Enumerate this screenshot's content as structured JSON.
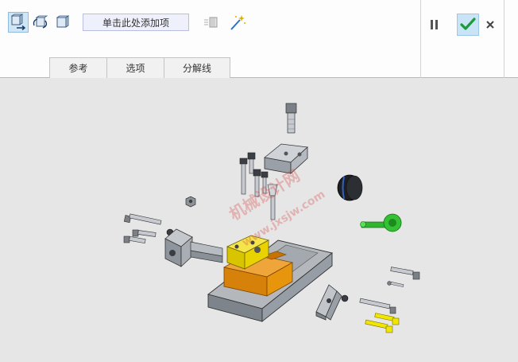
{
  "toolbar": {
    "collector_label": "单击此处添加项",
    "tools": [
      {
        "icon": "move-part-icon",
        "active": true
      },
      {
        "icon": "rotate-part-icon",
        "active": false
      },
      {
        "icon": "component-icon",
        "active": false
      },
      {
        "icon": "explode-lines-icon",
        "active": false
      },
      {
        "icon": "magic-wand-icon",
        "active": false
      }
    ]
  },
  "tabs": [
    {
      "label": "参考"
    },
    {
      "label": "选项"
    },
    {
      "label": "分解线"
    }
  ],
  "controls": {
    "pause": "pause-icon",
    "ok": "check-icon",
    "cancel": "close-icon"
  },
  "watermark": {
    "line1": "机械设计网",
    "line2": "www.jxsjw.com"
  },
  "colors": {
    "accent_ok": "#1d9a3a",
    "selected_part": "#2fb52f",
    "block_yellow": "#e8d300",
    "block_orange": "#e08a0a",
    "base_gray": "#a9a9a9"
  }
}
